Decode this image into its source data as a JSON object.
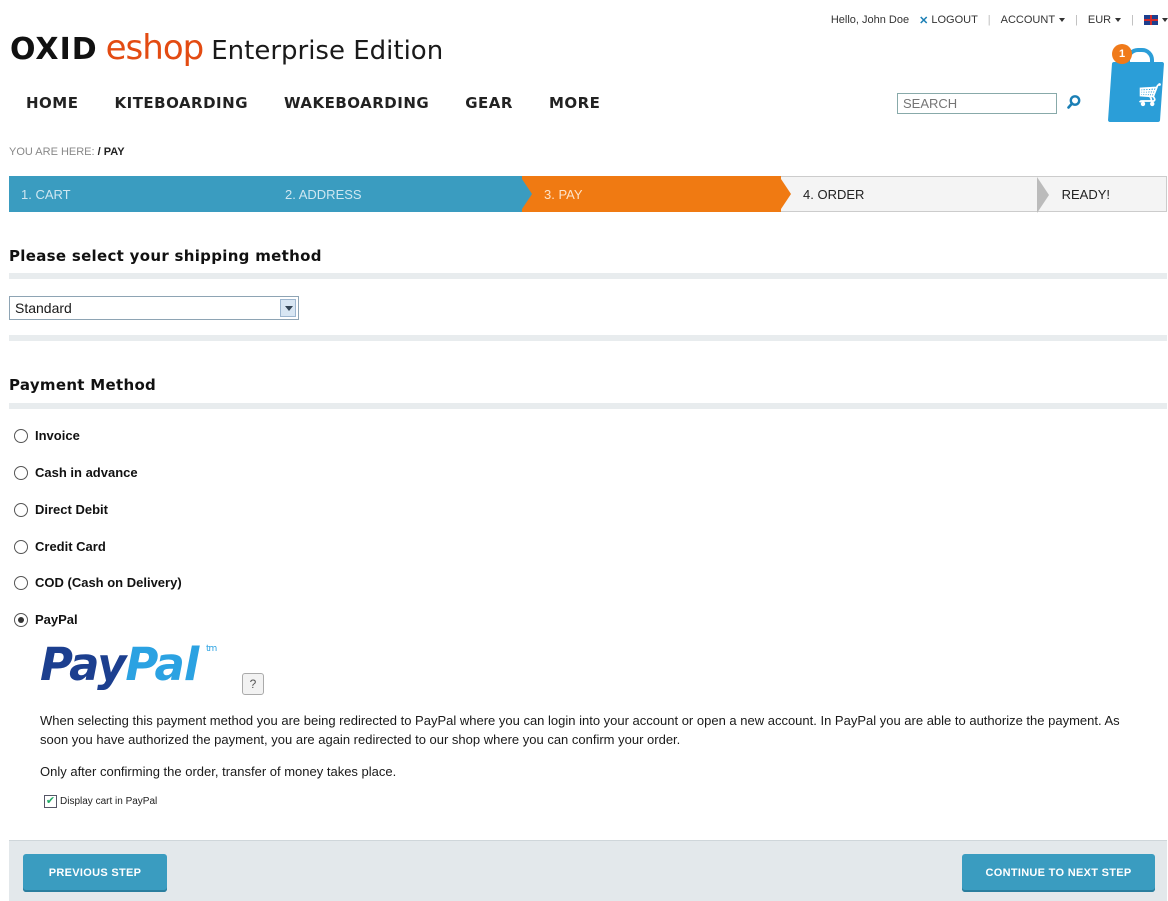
{
  "topbar": {
    "greeting": "Hello, John Doe",
    "logout": "LOGOUT",
    "account": "ACCOUNT",
    "currency": "EUR"
  },
  "logo": {
    "oxid": "OXID",
    "eshop": "eshop",
    "edition": "Enterprise Edition"
  },
  "cart": {
    "count": "1"
  },
  "nav": {
    "items": [
      "HOME",
      "KITEBOARDING",
      "WAKEBOARDING",
      "GEAR",
      "MORE"
    ]
  },
  "search": {
    "placeholder": "SEARCH"
  },
  "breadcrumb": {
    "label": "YOU ARE HERE:",
    "path": " / PAY"
  },
  "steps": [
    "1. CART",
    "2. ADDRESS",
    "3. PAY",
    "4. ORDER",
    "READY!"
  ],
  "shipping": {
    "heading": "Please select your shipping method",
    "selected": "Standard"
  },
  "payment": {
    "heading": "Payment Method",
    "options": [
      "Invoice",
      "Cash in advance",
      "Direct Debit",
      "Credit Card",
      "COD (Cash on Delivery)",
      "PayPal"
    ],
    "selected": "PayPal"
  },
  "paypal": {
    "logo_pay": "Pay",
    "logo_pal": "Pal",
    "tm": "tm",
    "help": "?",
    "description": "When selecting this payment method you are being redirected to PayPal where you can login into your account or open a new account. In PayPal you are able to authorize the payment. As soon you have authorized the payment, you are again redirected to our shop where you can confirm your order.",
    "note": "Only after confirming the order, transfer of money takes place.",
    "display_cart_label": "Display cart in PayPal"
  },
  "buttons": {
    "previous": "PREVIOUS STEP",
    "next": "CONTINUE TO NEXT STEP"
  },
  "colors": {
    "step_done": "#3a9cc0",
    "step_active": "#f07a12",
    "brand_orange": "#e34b12",
    "paypal_dark": "#1c3f8f",
    "paypal_light": "#2ba2e2"
  }
}
